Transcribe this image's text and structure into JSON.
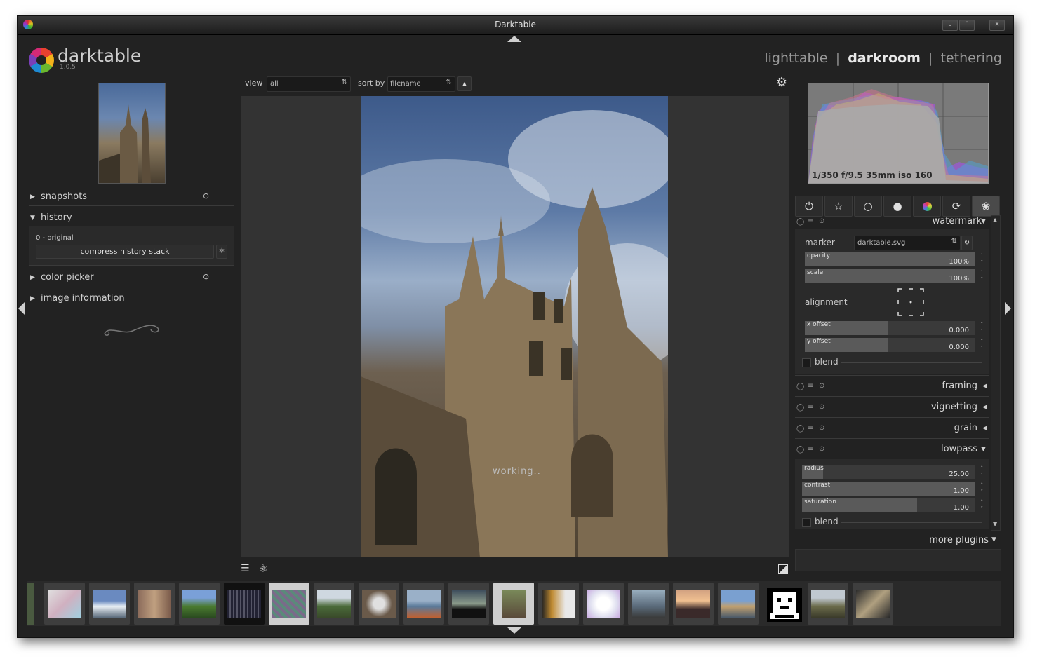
{
  "window": {
    "title": "Darktable"
  },
  "logo": {
    "name": "darktable",
    "version": "1.0.5"
  },
  "views": [
    {
      "label": "lighttable",
      "active": false
    },
    {
      "label": "darkroom",
      "active": true
    },
    {
      "label": "tethering",
      "active": false
    }
  ],
  "view_separator": "|",
  "left_panel": {
    "snapshots": "snapshots",
    "history": {
      "label": "history",
      "item": "0 - original",
      "compress_button": "compress history stack"
    },
    "color_picker": "color picker",
    "image_information": "image information"
  },
  "top_toolbar": {
    "view_label": "view",
    "view_value": "all",
    "sort_label": "sort by",
    "sort_value": "filename"
  },
  "center": {
    "status": "working.."
  },
  "histogram": {
    "exif": "1/350 f/9.5 35mm iso 160"
  },
  "watermark": {
    "title": "watermark",
    "marker_label": "marker",
    "marker_value": "darktable.svg",
    "opacity": {
      "label": "opacity",
      "value": "100%",
      "fraction": 1.0
    },
    "scale": {
      "label": "scale",
      "value": "100%",
      "fraction": 1.0
    },
    "alignment_label": "alignment",
    "x_offset": {
      "label": "x offset",
      "value": "0.000",
      "fraction": 0.5
    },
    "y_offset": {
      "label": "y offset",
      "value": "0.000",
      "fraction": 0.5
    },
    "blend": "blend"
  },
  "modules": [
    {
      "label": "framing",
      "expanded": false
    },
    {
      "label": "vignetting",
      "expanded": false
    },
    {
      "label": "grain",
      "expanded": false
    },
    {
      "label": "lowpass",
      "expanded": true
    }
  ],
  "lowpass": {
    "radius": {
      "label": "radius",
      "value": "25.00",
      "fraction": 0.12
    },
    "contrast": {
      "label": "contrast",
      "value": "1.00",
      "fraction": 1.0
    },
    "saturation": {
      "label": "saturation",
      "value": "1.00",
      "fraction": 0.65
    },
    "blend": "blend"
  },
  "more_plugins": "more plugins",
  "colors": {
    "accent_bg": "#222222",
    "panel": "#2b2b2b",
    "slider": "#3a3a3a",
    "slider_fill": "#5a5a5a"
  }
}
